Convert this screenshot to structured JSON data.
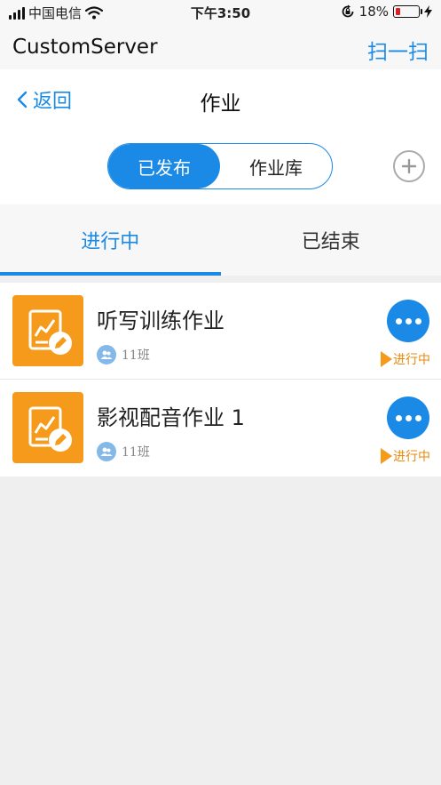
{
  "status_bar": {
    "carrier": "中国电信",
    "time": "下午3:50",
    "battery": "18%",
    "battery_level": 0.18
  },
  "app_bar": {
    "title": "CustomServer",
    "scan": "扫一扫"
  },
  "nav": {
    "back": "返回",
    "title": "作业"
  },
  "segments": [
    {
      "label": "已发布",
      "active": true
    },
    {
      "label": "作业库",
      "active": false
    }
  ],
  "tabs": [
    {
      "label": "进行中",
      "active": true
    },
    {
      "label": "已结束",
      "active": false
    }
  ],
  "homework": [
    {
      "title": "听写训练作业",
      "class_name": "11班",
      "status": "进行中"
    },
    {
      "title": "影视配音作业 1",
      "class_name": "11班",
      "status": "进行中"
    }
  ],
  "colors": {
    "accent": "#1a8ae6",
    "thumb": "#f59a1a",
    "status": "#e8890d",
    "battery_low": "#e02020"
  },
  "icons": {
    "back": "chevron-left-icon",
    "add": "plus-circle-icon",
    "thumb": "homework-chart-edit-icon",
    "class": "group-icon",
    "more": "more-dots-icon",
    "status": "play-triangle-icon"
  }
}
